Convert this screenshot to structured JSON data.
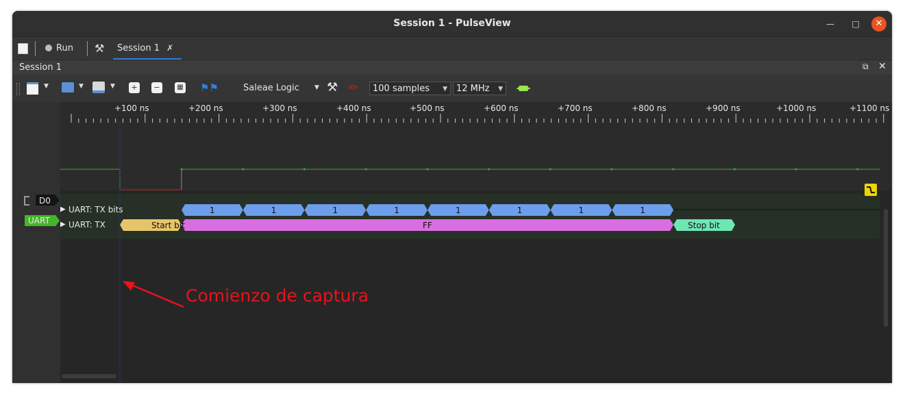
{
  "window": {
    "title": "Session 1 - PulseView"
  },
  "tabbar": {
    "run_label": "Run",
    "session_tab": "Session 1"
  },
  "session_bar": {
    "title": "Session 1"
  },
  "toolbar": {
    "device": "Saleae Logic",
    "samples": "100  samples",
    "rate": "12 MHz"
  },
  "ruler": {
    "ticks": [
      "+100 ns",
      "+200 ns",
      "+300 ns",
      "+400 ns",
      "+500 ns",
      "+600 ns",
      "+700 ns",
      "+800 ns",
      "+900 ns",
      "+1000 ns",
      "+1100 ns"
    ]
  },
  "channels": {
    "d0": "D0",
    "uart_badge": "UART",
    "tx_bits": "UART: TX bits",
    "tx": "UART: TX"
  },
  "decode": {
    "bits": [
      "1",
      "1",
      "1",
      "1",
      "1",
      "1",
      "1",
      "1"
    ],
    "start": "Start bit",
    "data": "FF",
    "stop": "Stop bit"
  },
  "annotation": {
    "text": "Comienzo de captura"
  },
  "colors": {
    "bits": "#6d9eeb",
    "start": "#e6c56a",
    "data": "#d96ee0",
    "stop": "#6ee6b4",
    "trace": "#2db52d",
    "trace_low": "#d41b1b",
    "annotation": "#e8131c"
  }
}
